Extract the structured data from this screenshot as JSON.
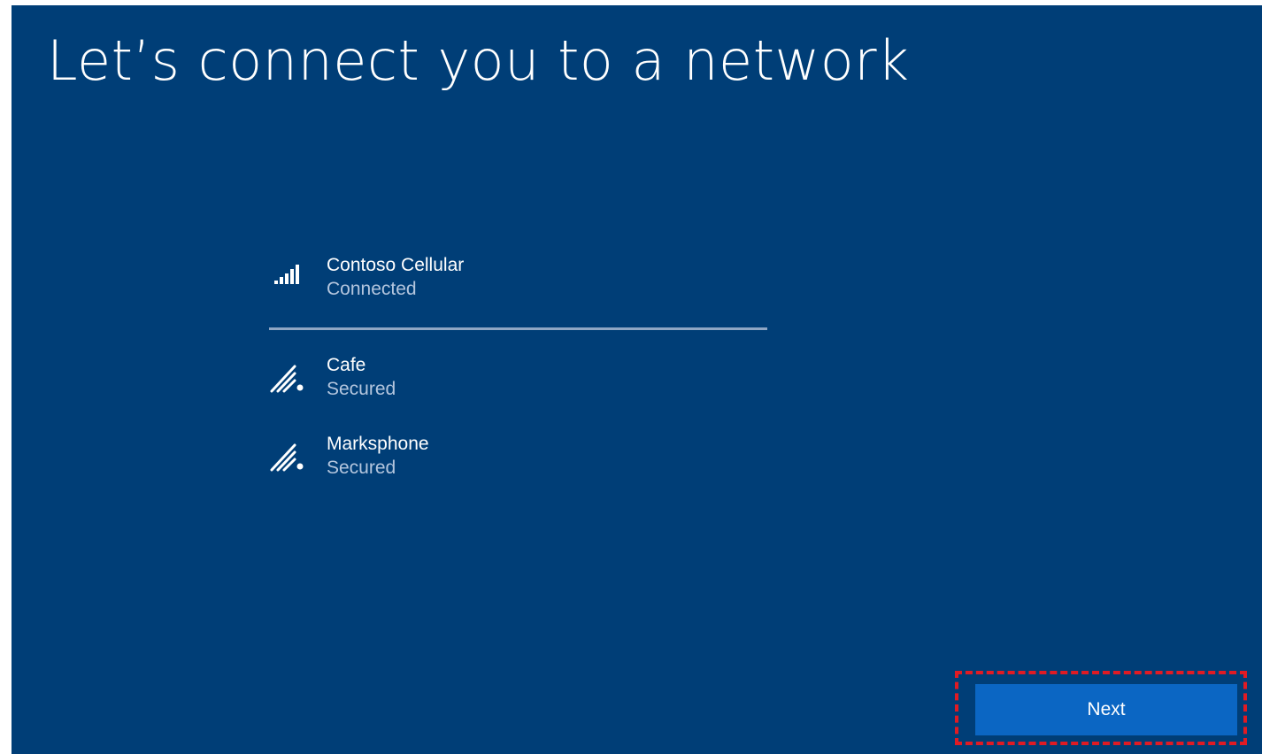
{
  "page": {
    "title": "Let’s connect you to a network"
  },
  "networks": [
    {
      "name": "Contoso Cellular",
      "status": "Connected",
      "icon": "cellular-signal-icon"
    },
    {
      "name": "Cafe",
      "status": "Secured",
      "icon": "wifi-icon"
    },
    {
      "name": "Marksphone",
      "status": "Secured",
      "icon": "wifi-icon"
    }
  ],
  "footer": {
    "next_label": "Next"
  },
  "colors": {
    "background": "#003e77",
    "button": "#0b66c3",
    "highlight": "#e01b24",
    "text": "#ffffff",
    "status_text": "#b4c6de"
  }
}
